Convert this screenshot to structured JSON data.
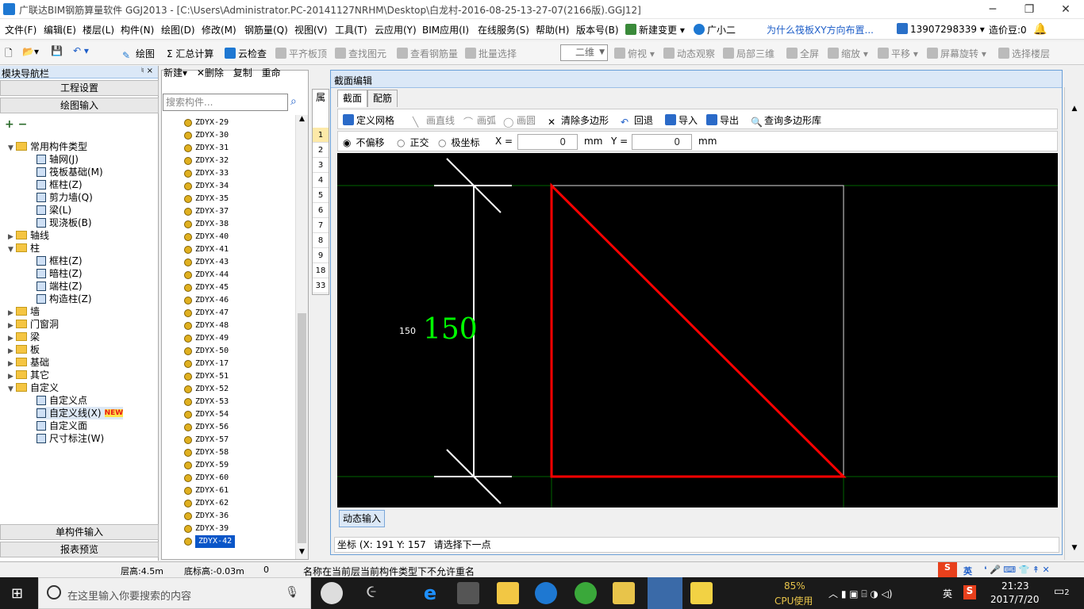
{
  "window": {
    "title": "广联达BIM钢筋算量软件 GGJ2013 - [C:\\Users\\Administrator.PC-20141127NRHM\\Desktop\\白龙村-2016-08-25-13-27-07(2166版).GGJ12]",
    "min": "─",
    "max": "❐",
    "close": "✕"
  },
  "menu": [
    "文件(F)",
    "编辑(E)",
    "楼层(L)",
    "构件(N)",
    "绘图(D)",
    "修改(M)",
    "钢筋量(Q)",
    "视图(V)",
    "工具(T)",
    "云应用(Y)",
    "BIM应用(I)",
    "在线服务(S)",
    "帮助(H)",
    "版本号(B)",
    "新建变更 ▾",
    "广小二"
  ],
  "menu_link": "为什么筏板XY方向布置...",
  "menu_user": "13907298339 ▾",
  "menu_cost": "造价豆:0",
  "toolbar": {
    "draw": "绘图",
    "sum": "Σ 汇总计算",
    "cloud": "云检查",
    "flat": "平齐板顶",
    "find": "查找图元",
    "viewrebar": "查看钢筋量",
    "batch": "批量选择",
    "mode": "二维",
    "view": "俯视 ▾",
    "dyn": "动态观察",
    "local3d": "局部三维",
    "fullscreen": "全屏",
    "zoom": "缩放 ▾",
    "pan": "平移 ▾",
    "rotate": "屏幕旋转 ▾",
    "floor": "选择楼层"
  },
  "nav": {
    "title": "模块导航栏",
    "pin": "♮ ×",
    "project": "工程设置",
    "drawinput": "绘图输入",
    "single": "单构件输入",
    "report": "报表预览"
  },
  "tree": [
    {
      "l": "常用构件类型",
      "lvl": 0,
      "t": "folder",
      "exp": "v"
    },
    {
      "l": "轴网(J)",
      "lvl": 1,
      "t": "c"
    },
    {
      "l": "筏板基础(M)",
      "lvl": 1,
      "t": "c"
    },
    {
      "l": "框柱(Z)",
      "lvl": 1,
      "t": "c"
    },
    {
      "l": "剪力墙(Q)",
      "lvl": 1,
      "t": "c"
    },
    {
      "l": "梁(L)",
      "lvl": 1,
      "t": "c"
    },
    {
      "l": "现浇板(B)",
      "lvl": 1,
      "t": "c"
    },
    {
      "l": "轴线",
      "lvl": 0,
      "t": "folder",
      "exp": ">"
    },
    {
      "l": "柱",
      "lvl": 0,
      "t": "folder",
      "exp": "v"
    },
    {
      "l": "框柱(Z)",
      "lvl": 1,
      "t": "c"
    },
    {
      "l": "暗柱(Z)",
      "lvl": 1,
      "t": "c"
    },
    {
      "l": "端柱(Z)",
      "lvl": 1,
      "t": "c"
    },
    {
      "l": "构造柱(Z)",
      "lvl": 1,
      "t": "c"
    },
    {
      "l": "墙",
      "lvl": 0,
      "t": "folder",
      "exp": ">"
    },
    {
      "l": "门窗洞",
      "lvl": 0,
      "t": "folder",
      "exp": ">"
    },
    {
      "l": "梁",
      "lvl": 0,
      "t": "folder",
      "exp": ">"
    },
    {
      "l": "板",
      "lvl": 0,
      "t": "folder",
      "exp": ">"
    },
    {
      "l": "基础",
      "lvl": 0,
      "t": "folder",
      "exp": ">"
    },
    {
      "l": "其它",
      "lvl": 0,
      "t": "folder",
      "exp": ">"
    },
    {
      "l": "自定义",
      "lvl": 0,
      "t": "folder",
      "exp": "v"
    },
    {
      "l": "自定义点",
      "lvl": 1,
      "t": "c"
    },
    {
      "l": "自定义线(X)",
      "lvl": 1,
      "t": "c",
      "badge": "NEW"
    },
    {
      "l": "自定义面",
      "lvl": 1,
      "t": "c"
    },
    {
      "l": "尺寸标注(W)",
      "lvl": 1,
      "t": "c"
    }
  ],
  "mid": {
    "new": "新建▾",
    "del": "删除",
    "copy": "复制",
    "rename": "重命",
    "search": "搜索构件...",
    "items": [
      "ZDYX-29",
      "ZDYX-30",
      "ZDYX-31",
      "ZDYX-32",
      "ZDYX-33",
      "ZDYX-34",
      "ZDYX-35",
      "ZDYX-37",
      "ZDYX-38",
      "ZDYX-40",
      "ZDYX-41",
      "ZDYX-43",
      "ZDYX-44",
      "ZDYX-45",
      "ZDYX-46",
      "ZDYX-47",
      "ZDYX-48",
      "ZDYX-49",
      "ZDYX-50",
      "ZDYX-17",
      "ZDYX-51",
      "ZDYX-52",
      "ZDYX-53",
      "ZDYX-54",
      "ZDYX-56",
      "ZDYX-57",
      "ZDYX-58",
      "ZDYX-59",
      "ZDYX-60",
      "ZDYX-61",
      "ZDYX-62",
      "ZDYX-36",
      "ZDYX-39",
      "ZDYX-42"
    ]
  },
  "strip": {
    "head": "属",
    "rows": [
      "1",
      "2",
      "3",
      "4",
      "5",
      "6",
      "7",
      "8",
      "9",
      "18",
      "33"
    ]
  },
  "dialog": {
    "title": "截面编辑",
    "tab1": "截面",
    "tab2": "配筋",
    "tools": {
      "grid": "定义网格",
      "line": "画直线",
      "arc": "画弧",
      "circle": "画圆",
      "clear": "清除多边形",
      "undo": "回退",
      "import": "导入",
      "export": "导出",
      "query": "查询多边形库"
    },
    "coord": {
      "r1": "不偏移",
      "r2": "正交",
      "r3": "极坐标",
      "xl": "X =",
      "xv": "0",
      "yl": "Y =",
      "yv": "0",
      "unit": "mm"
    },
    "dim_small": "150",
    "dim_big": "150",
    "dyn": "动态输入",
    "status_coord": "坐标 (X: 191 Y: 157",
    "status_msg": "请选择下一点"
  },
  "status": {
    "floor": "层高:4.5m",
    "bottom": "底标高:-0.03m",
    "zero": "0",
    "msg": "名称在当前层当前构件类型下不允许重名"
  },
  "taskbar": {
    "search": "在这里输入你要搜索的内容",
    "cpu": "85%",
    "cpulbl": "CPU使用",
    "ime": "英",
    "time": "21:23",
    "date": "2017/7/20",
    "notif": "2"
  },
  "colors": {
    "accent": "#1e78d2",
    "triangle": "#ff0000",
    "dim": "#00ff00"
  }
}
